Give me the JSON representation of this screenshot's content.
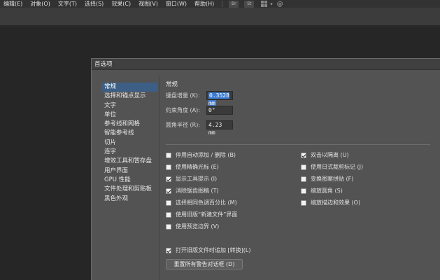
{
  "menubar": {
    "items": [
      "编辑(E)",
      "对象(O)",
      "文字(T)",
      "选择(S)",
      "效果(C)",
      "视图(V)",
      "窗口(W)",
      "帮助(H)"
    ],
    "app_icons": [
      "Br",
      "St"
    ]
  },
  "dialog": {
    "title": "首选项",
    "nav": [
      "常规",
      "选择和锚点显示",
      "文字",
      "单位",
      "参考线和网格",
      "智能参考线",
      "切片",
      "连字",
      "增效工具和暂存盘",
      "用户界面",
      "GPU 性能",
      "文件处理和剪贴板",
      "黑色外观"
    ],
    "active_nav": "常规",
    "section_title": "常规",
    "fields": {
      "keyboard_increment_label": "键盘增量 (K):",
      "keyboard_increment_value": "0.3528 mm",
      "constrain_angle_label": "约束角度 (A):",
      "constrain_angle_value": "0°",
      "corner_radius_label": "圆角半径 (R):",
      "corner_radius_value": "4.23 mm"
    },
    "checkboxes_left": [
      {
        "label": "停用自动添加 / 删除 (B)",
        "checked": false
      },
      {
        "label": "使用精确光标 (E)",
        "checked": false
      },
      {
        "label": "显示工具提示 (I)",
        "checked": true
      },
      {
        "label": "消除锯齿图稿 (T)",
        "checked": true
      },
      {
        "label": "选择相同色调百分比 (M)",
        "checked": false
      },
      {
        "label": "使用旧版“新建文件”界面",
        "checked": false
      },
      {
        "label": "使用预览边界 (V)",
        "checked": false
      },
      {
        "label": "",
        "checked": false
      },
      {
        "label": "打开旧版文件时追加 [转换](L)",
        "checked": true
      }
    ],
    "checkboxes_right": [
      {
        "label": "双击以隔离 (U)",
        "checked": true
      },
      {
        "label": "使用日式裁剪标记 (J)",
        "checked": false
      },
      {
        "label": "变换图案拼贴 (F)",
        "checked": false
      },
      {
        "label": "缩放圆角 (S)",
        "checked": false
      },
      {
        "label": "缩放描边和效果 (O)",
        "checked": false
      }
    ],
    "reset_button": "重置所有警告对话框 (D)"
  }
}
